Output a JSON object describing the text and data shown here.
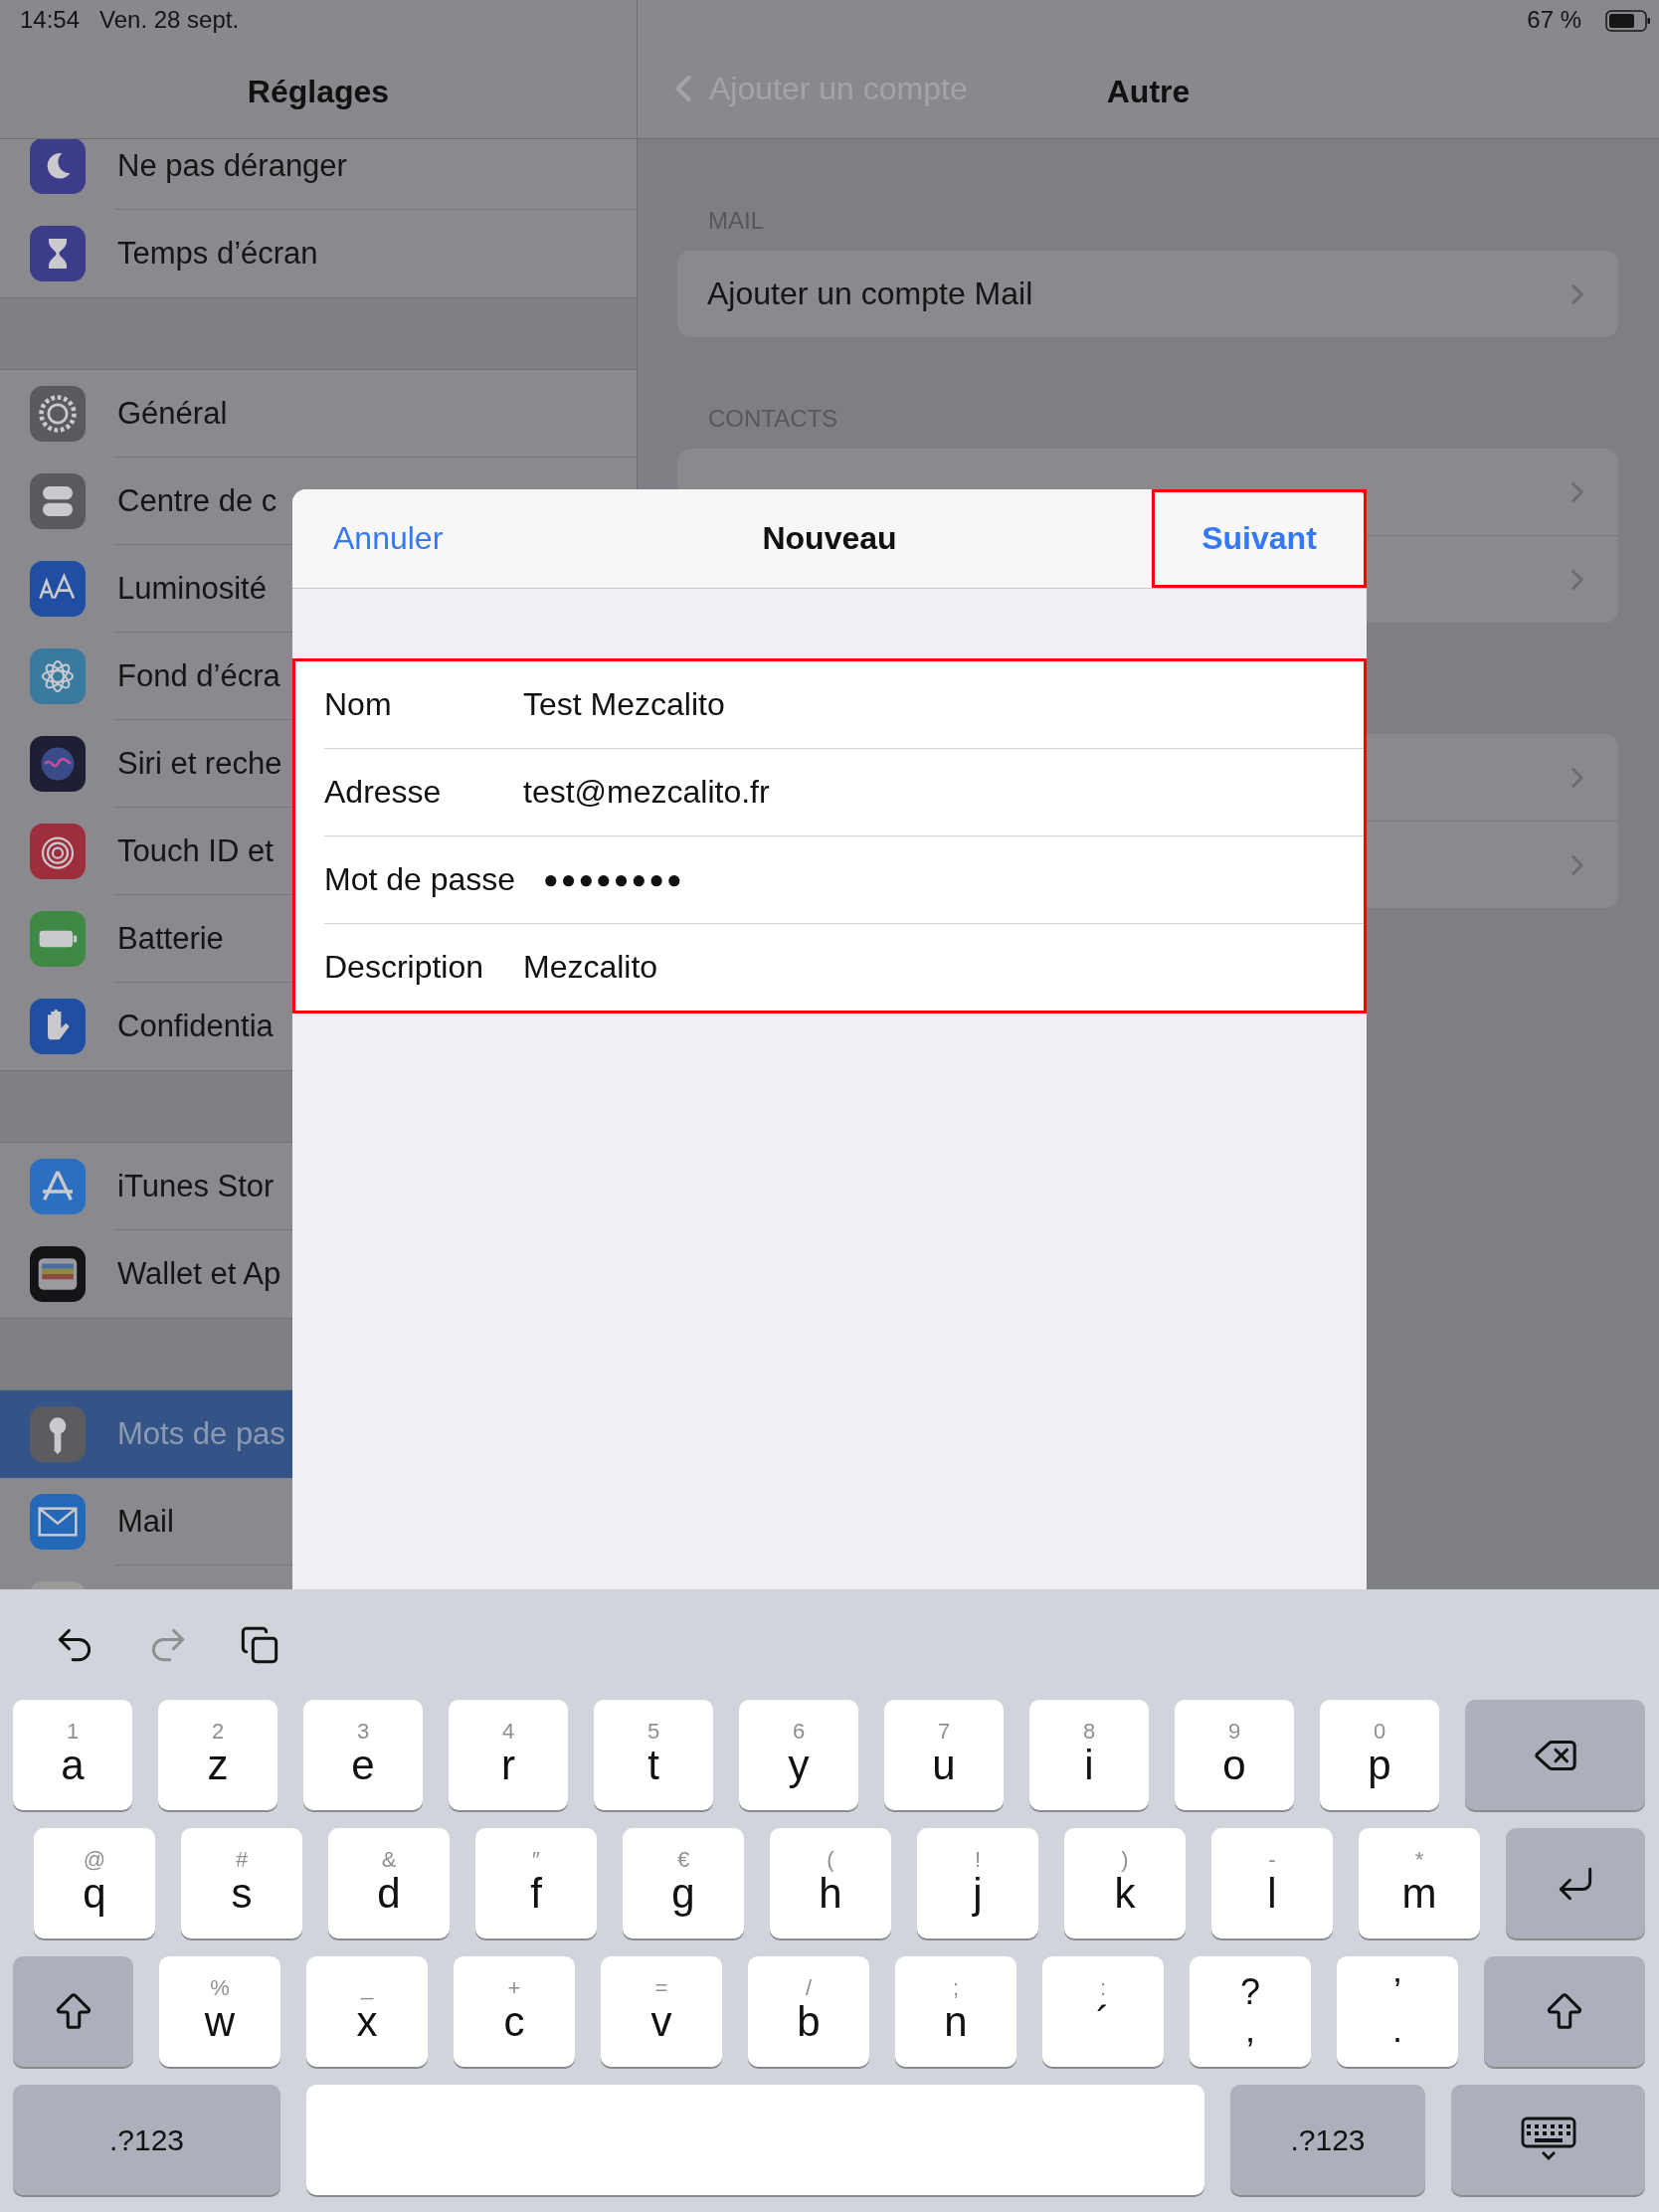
{
  "status_bar": {
    "time": "14:54",
    "date": "Ven. 28 sept.",
    "battery": "67 %"
  },
  "sidebar": {
    "title": "Réglages",
    "groups": [
      {
        "items": [
          {
            "label": "Ne pas déranger",
            "color": "#3c3c8a",
            "selected": false
          },
          {
            "label": "Temps d’écran",
            "color": "#3c3c8a",
            "selected": false
          }
        ]
      },
      {
        "items": [
          {
            "label": "Général",
            "color": "#5a5a5e",
            "selected": false
          },
          {
            "label": "Centre de c",
            "color": "#5a5a5e",
            "selected": false
          },
          {
            "label": "Luminosité",
            "color": "#1f4ea3",
            "selected": false
          },
          {
            "label": "Fond d’écra",
            "color": "#3a7a9e",
            "selected": false
          },
          {
            "label": "Siri et reche",
            "color": "#1e1e34",
            "selected": false
          },
          {
            "label": "Touch ID et",
            "color": "#9e2e3c",
            "selected": false
          },
          {
            "label": "Batterie",
            "color": "#3e8a44",
            "selected": false
          },
          {
            "label": "Confidentia",
            "color": "#1f4ea3",
            "selected": false
          }
        ]
      },
      {
        "items": [
          {
            "label": "iTunes Stor",
            "color": "#2a6fc0",
            "selected": false
          },
          {
            "label": "Wallet et Ap",
            "color": "#141416",
            "selected": false
          }
        ]
      },
      {
        "items": [
          {
            "label": "Mots de pas",
            "color": "#5c5c60",
            "selected": true
          },
          {
            "label": "Mail",
            "color": "#2468b8",
            "selected": false
          },
          {
            "color": "#9a9a9a",
            "selected": false
          }
        ]
      }
    ]
  },
  "detail": {
    "back": "Ajouter un compte",
    "title": "Autre",
    "sections": [
      {
        "header": "MAIL",
        "rows": [
          {
            "label": "Ajouter un compte Mail"
          }
        ]
      },
      {
        "header": "CONTACTS",
        "rows": [
          {},
          {}
        ]
      },
      {
        "rows": [
          {},
          {}
        ]
      }
    ]
  },
  "modal": {
    "cancel": "Annuler",
    "title": "Nouveau",
    "next": "Suivant",
    "fields": [
      {
        "label": "Nom",
        "value": "Test Mezcalito",
        "kind": "text"
      },
      {
        "label": "Adresse",
        "value": "test@mezcalito.fr",
        "kind": "text"
      },
      {
        "label": "Mot de passe",
        "value": "●●●●●●●●",
        "kind": "password"
      },
      {
        "label": "Description",
        "value": "Mezcalito",
        "kind": "text"
      }
    ]
  },
  "keyboard": {
    "rows": [
      [
        {
          "kind": "letter",
          "hint": "1",
          "label": "a"
        },
        {
          "kind": "letter",
          "hint": "2",
          "label": "z"
        },
        {
          "kind": "letter",
          "hint": "3",
          "label": "e"
        },
        {
          "kind": "letter",
          "hint": "4",
          "label": "r"
        },
        {
          "kind": "letter",
          "hint": "5",
          "label": "t"
        },
        {
          "kind": "letter",
          "hint": "6",
          "label": "y"
        },
        {
          "kind": "letter",
          "hint": "7",
          "label": "u"
        },
        {
          "kind": "letter",
          "hint": "8",
          "label": "i"
        },
        {
          "kind": "letter",
          "hint": "9",
          "label": "o"
        },
        {
          "kind": "letter",
          "hint": "0",
          "label": "p"
        },
        {
          "kind": "delete"
        }
      ],
      [
        {
          "kind": "letter",
          "hint": "@",
          "label": "q"
        },
        {
          "kind": "letter",
          "hint": "#",
          "label": "s"
        },
        {
          "kind": "letter",
          "hint": "&",
          "label": "d"
        },
        {
          "kind": "letter",
          "hint": "″",
          "label": "f"
        },
        {
          "kind": "letter",
          "hint": "€",
          "label": "g"
        },
        {
          "kind": "letter",
          "hint": "(",
          "label": "h"
        },
        {
          "kind": "letter",
          "hint": "!",
          "label": "j"
        },
        {
          "kind": "letter",
          "hint": ")",
          "label": "k"
        },
        {
          "kind": "letter",
          "hint": "-",
          "label": "l"
        },
        {
          "kind": "letter",
          "hint": "*",
          "label": "m"
        },
        {
          "kind": "return"
        }
      ],
      [
        {
          "kind": "shift"
        },
        {
          "kind": "letter",
          "hint": "%",
          "label": "w"
        },
        {
          "kind": "letter",
          "hint": "_",
          "label": "x"
        },
        {
          "kind": "letter",
          "hint": "+",
          "label": "c"
        },
        {
          "kind": "letter",
          "hint": "=",
          "label": "v"
        },
        {
          "kind": "letter",
          "hint": "/",
          "label": "b"
        },
        {
          "kind": "letter",
          "hint": ";",
          "label": "n"
        },
        {
          "kind": "letter",
          "hint": ":",
          "label": "´"
        },
        {
          "kind": "dual",
          "hint": "?",
          "label": ","
        },
        {
          "kind": "dual",
          "hint": "’",
          "label": "."
        },
        {
          "kind": "shift"
        }
      ],
      [
        {
          "kind": "mode",
          "label": ".?123"
        },
        {
          "kind": "space"
        },
        {
          "kind": "mode",
          "label": ".?123"
        },
        {
          "kind": "dismiss"
        }
      ]
    ]
  }
}
